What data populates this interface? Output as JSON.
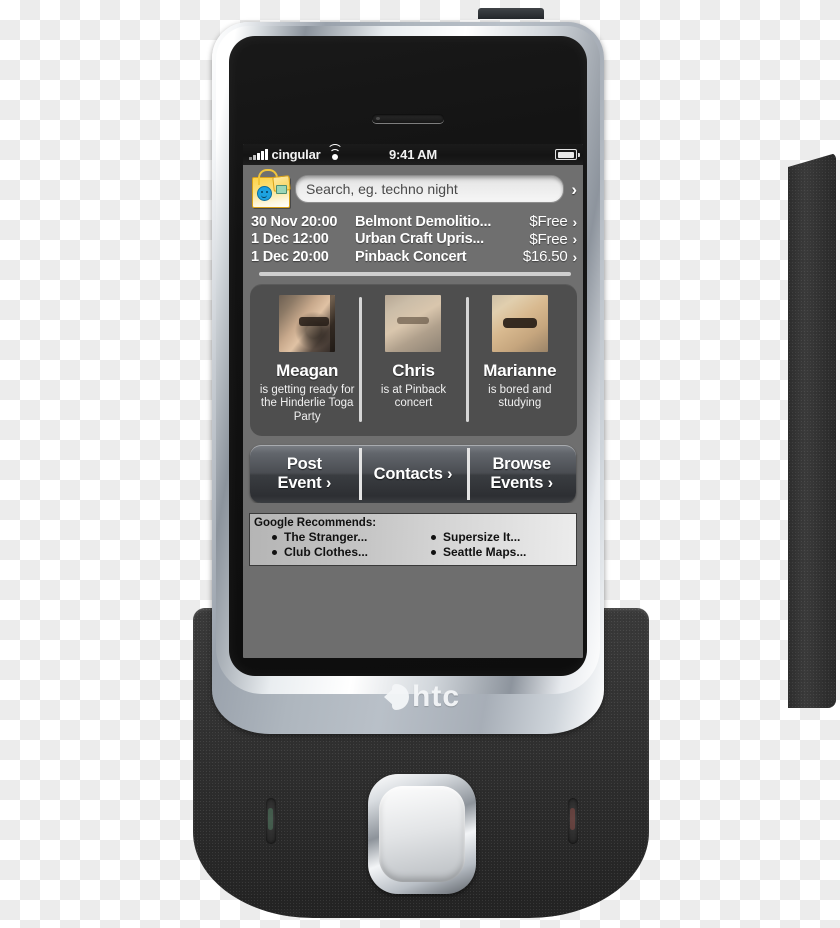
{
  "device": {
    "brand": "HTC",
    "brand_mark": "htc-logo-mark"
  },
  "statusbar": {
    "carrier": "cingular",
    "signal_icon": "signal-bars-icon",
    "wifi_icon": "wifi-icon",
    "clock": "9:41 AM",
    "battery_icon": "battery-full-icon"
  },
  "search": {
    "app_icon": "shopping-bag-icon",
    "placeholder": "Search, eg. techno night",
    "value": "Search, eg. techno night",
    "submit_chevron": "›"
  },
  "events": {
    "chevron": "›",
    "items": [
      {
        "date": "30 Nov 20:00",
        "title": "Belmont Demolitio...",
        "price": "$Free"
      },
      {
        "date": "1 Dec 12:00",
        "title": "Urban Craft Upris...",
        "price": "$Free"
      },
      {
        "date": "1 Dec 20:00",
        "title": "Pinback Concert",
        "price": "$16.50"
      }
    ]
  },
  "friends": [
    {
      "name": "Meagan",
      "status": "is getting ready for the Hinderlie Toga Party",
      "avatar": "avatar-meagan"
    },
    {
      "name": "Chris",
      "status": "is at Pinback concert",
      "avatar": "avatar-chris"
    },
    {
      "name": "Marianne",
      "status": "is bored  and studying",
      "avatar": "avatar-marianne"
    }
  ],
  "actions": [
    {
      "line1": "Post",
      "line2": "Event ›",
      "name": "post-event"
    },
    {
      "line1": "",
      "line2": "Contacts ›",
      "name": "contacts"
    },
    {
      "line1": "Browse",
      "line2": "Events ›",
      "name": "browse-events"
    }
  ],
  "google": {
    "title": "Google Recommends:",
    "column_left": [
      "The Stranger...",
      "Club Clothes..."
    ],
    "column_right": [
      "Supersize It...",
      "Seattle Maps..."
    ]
  },
  "colors": {
    "screen_bg": "#6e6e6e",
    "statusbar_bg": "#151515",
    "panel_bg": "#4e4e4e",
    "accent_text": "#ffffff",
    "bag_yellow": "#fbd44f",
    "bag_smiley_blue": "#1da2e0",
    "google_panel": "#c8c8c8"
  }
}
